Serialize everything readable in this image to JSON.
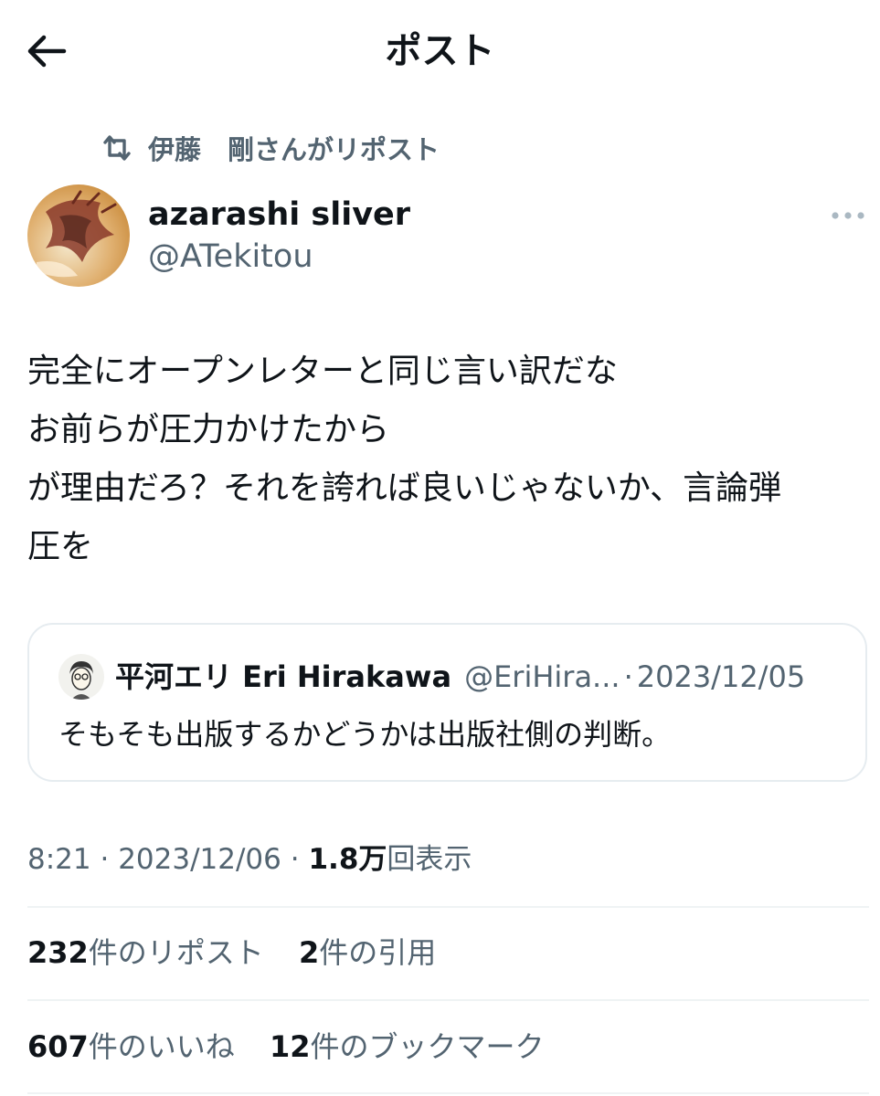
{
  "header": {
    "title": "ポスト",
    "back_icon": "arrow-left-icon"
  },
  "repost_context": {
    "icon": "repost-icon",
    "text": "伊藤　剛さんがリポスト"
  },
  "post": {
    "author": {
      "name": "azarashi sliver",
      "handle": "@ATekitou"
    },
    "more_icon": "more-dots-icon",
    "text": "完全にオープンレターと同じ言い訳だな\nお前らが圧力かけたから\nが理由だろ？それを誇れば良いじゃないか、言論弾\n圧を",
    "quote": {
      "author_name": "平河エリ Eri Hirakawa",
      "author_handle": "@EriHira...",
      "separator": "·",
      "date": "2023/12/05",
      "text": "そもそも出版するかどうかは出版社側の判断。"
    },
    "meta": {
      "time": "8:21",
      "separator": "·",
      "date": "2023/12/06",
      "views_count": "1.8万",
      "views_label": "回表示"
    },
    "stats": {
      "reposts": {
        "count": "232",
        "label": "件のリポスト"
      },
      "quotes": {
        "count": "2",
        "label": "件の引用"
      },
      "likes": {
        "count": "607",
        "label": "件のいいね"
      },
      "bookmarks": {
        "count": "12",
        "label": "件のブックマーク"
      }
    }
  },
  "colors": {
    "text_primary": "#0f1419",
    "text_secondary": "#536471",
    "border": "#e6ecf0"
  }
}
